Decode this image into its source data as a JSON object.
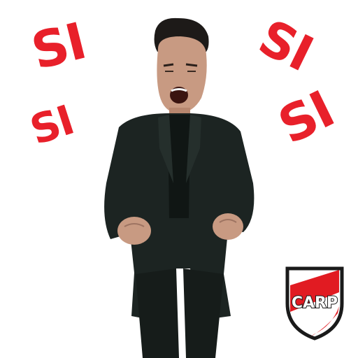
{
  "sticker": {
    "words": [
      "SI",
      "SI",
      "SI",
      "SI"
    ]
  },
  "crest": {
    "letters": "CARP",
    "colors": {
      "red": "#e11b22",
      "black": "#1a1a1a",
      "white": "#ffffff"
    }
  },
  "colors": {
    "word_fill": "#e8202a",
    "suit": "#1c2422"
  },
  "icons": [
    "person-celebrating-image",
    "river-plate-crest-icon"
  ]
}
